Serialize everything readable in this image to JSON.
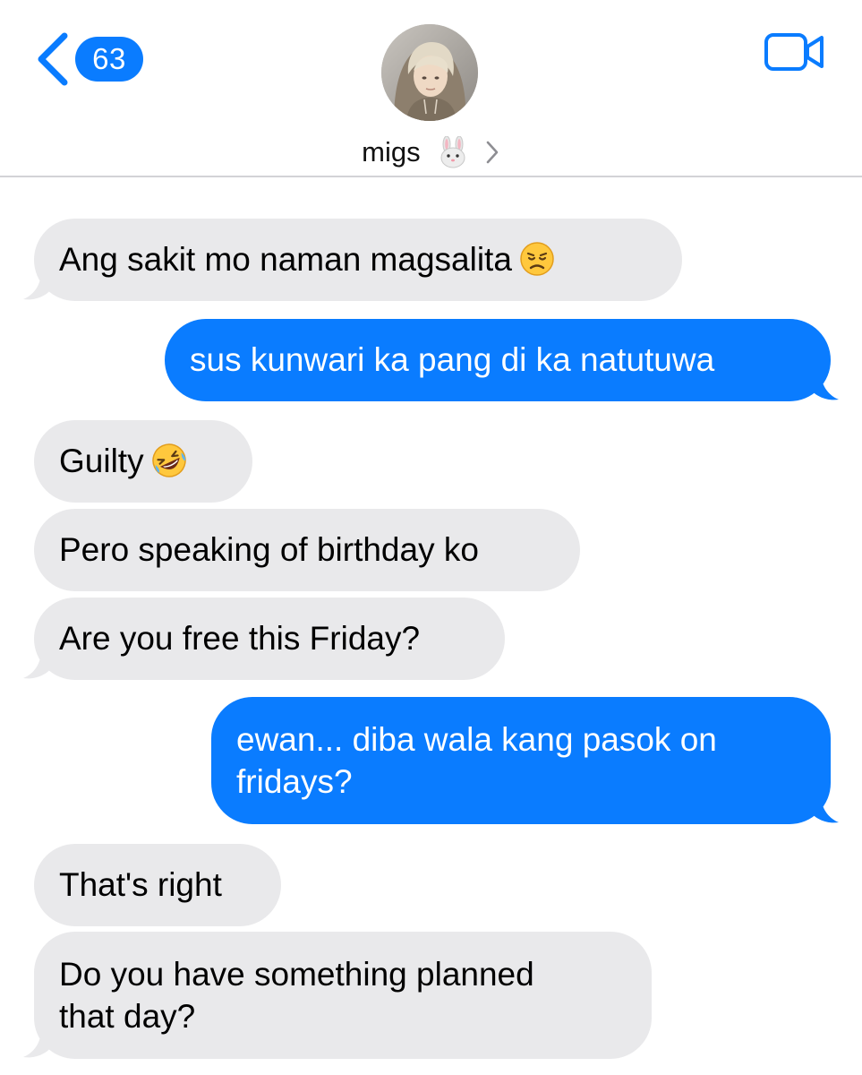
{
  "header": {
    "back_count": "63",
    "contact_name": "migs",
    "colors": {
      "accent": "#0a7cff",
      "incoming_bubble": "#e9e9eb",
      "divider": "#d3d3d6"
    },
    "icons": [
      "back-chevron-icon",
      "bunny-emoji-icon",
      "chevron-right-icon",
      "video-camera-icon"
    ]
  },
  "messages": [
    {
      "direction": "incoming",
      "text": "Ang sakit mo naman magsalita",
      "emoji": "disappointed-face-emoji"
    },
    {
      "direction": "outgoing",
      "text": "sus kunwari ka pang di ka natutuwa"
    },
    {
      "direction": "incoming",
      "text": "Guilty",
      "emoji": "rolling-on-the-floor-laughing-emoji"
    },
    {
      "direction": "incoming",
      "text": "Pero speaking of birthday ko"
    },
    {
      "direction": "incoming",
      "text": "Are you free this Friday?"
    },
    {
      "direction": "outgoing",
      "text": "ewan... diba wala kang pasok on\nfridays?"
    },
    {
      "direction": "incoming",
      "text": "That's right"
    },
    {
      "direction": "incoming",
      "text": "Do you have something planned\nthat day?"
    }
  ]
}
